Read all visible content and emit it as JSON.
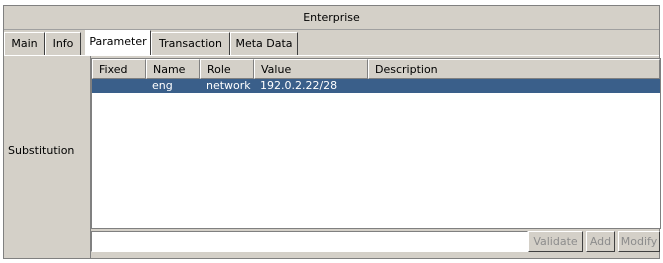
{
  "window": {
    "title": "Enterprise"
  },
  "tabs": [
    {
      "label": "Main",
      "active": false
    },
    {
      "label": "Info",
      "active": false
    },
    {
      "label": "Parameter",
      "active": true
    },
    {
      "label": "Transaction",
      "active": false
    },
    {
      "label": "Meta Data",
      "active": false
    }
  ],
  "section": {
    "label": "Substitution"
  },
  "table": {
    "columns": [
      "Fixed",
      "Name",
      "Role",
      "Value",
      "Description"
    ],
    "rows": [
      {
        "fixed": "",
        "name": "eng",
        "role": "network",
        "value": "192.0.2.22/28",
        "description": ""
      }
    ],
    "selected_row_color": "#3a5f8a"
  },
  "input": {
    "value": "",
    "placeholder": ""
  },
  "buttons": {
    "validate": "Validate",
    "add": "Add",
    "modify": "Modify"
  }
}
